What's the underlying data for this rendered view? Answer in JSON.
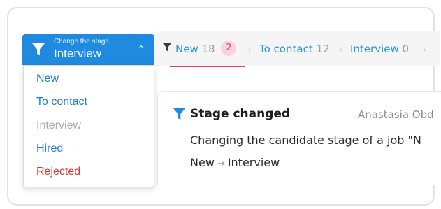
{
  "stage_selector": {
    "hint": "Change the stage",
    "value": "Interview",
    "options": [
      {
        "label": "New",
        "state": "active"
      },
      {
        "label": "To contact",
        "state": "active"
      },
      {
        "label": "Interview",
        "state": "current"
      },
      {
        "label": "Hired",
        "state": "active"
      },
      {
        "label": "Rejected",
        "state": "danger"
      }
    ]
  },
  "tabs": [
    {
      "label": "New",
      "count": "18",
      "badge": "2"
    },
    {
      "label": "To contact",
      "count": "12"
    },
    {
      "label": "Interview",
      "count": "0"
    }
  ],
  "event": {
    "title": "Stage changed",
    "author": "Anastasia Obd",
    "description": "Changing the candidate stage of a job \"N",
    "from": "New",
    "to": "Interview"
  },
  "colors": {
    "accent": "#1e8ae0",
    "link": "#1b7fd0",
    "danger": "#e3332e",
    "badge_bg": "#fbd3dc",
    "tab_underline": "#d7446a"
  },
  "icons": {
    "filter": "filter-icon",
    "chevron": "chevron-up-icon",
    "separator": "chevron-right-icon",
    "arrow": "arrow-right-icon"
  }
}
